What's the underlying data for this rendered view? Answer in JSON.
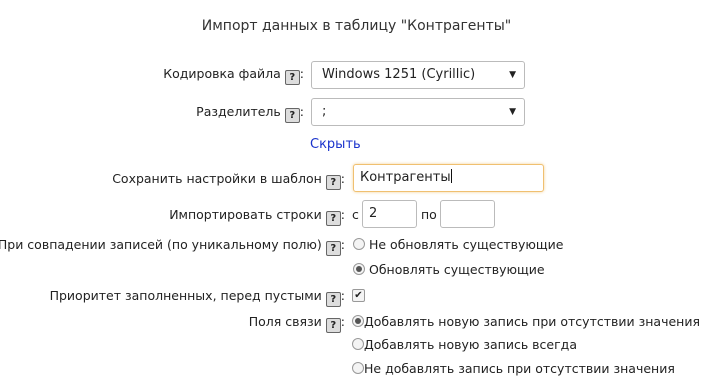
{
  "title": "Импорт данных в таблицу \"Контрагенты\"",
  "help_glyph": "?",
  "encoding": {
    "label": "Кодировка файла",
    "value": "Windows 1251 (Cyrillic)"
  },
  "separator": {
    "label": "Разделитель",
    "value": ";"
  },
  "toggle_link": "Скрыть",
  "save_template": {
    "label": "Сохранить настройки в шаблон",
    "value": "Контрагенты"
  },
  "import_rows": {
    "label": "Импортировать строки",
    "from_label": "с",
    "from_value": "2",
    "to_label": "по",
    "to_value": ""
  },
  "on_match": {
    "label": "При совпадении записей (по уникальному полю)",
    "options": [
      {
        "label": "Не обновлять существующие",
        "selected": false
      },
      {
        "label": "Обновлять существующие",
        "selected": true
      }
    ]
  },
  "priority_filled": {
    "label": "Приоритет заполненных, перед пустыми",
    "checked": true,
    "mark": "✔"
  },
  "link_fields": {
    "label": "Поля связи",
    "options": [
      {
        "label": "Добавлять новую запись при отсутствии значения",
        "selected": true
      },
      {
        "label": "Добавлять новую запись всегда",
        "selected": false
      },
      {
        "label": "Не добавлять запись при отсутствии значения",
        "selected": false
      }
    ]
  },
  "arrow_glyph": "▼"
}
